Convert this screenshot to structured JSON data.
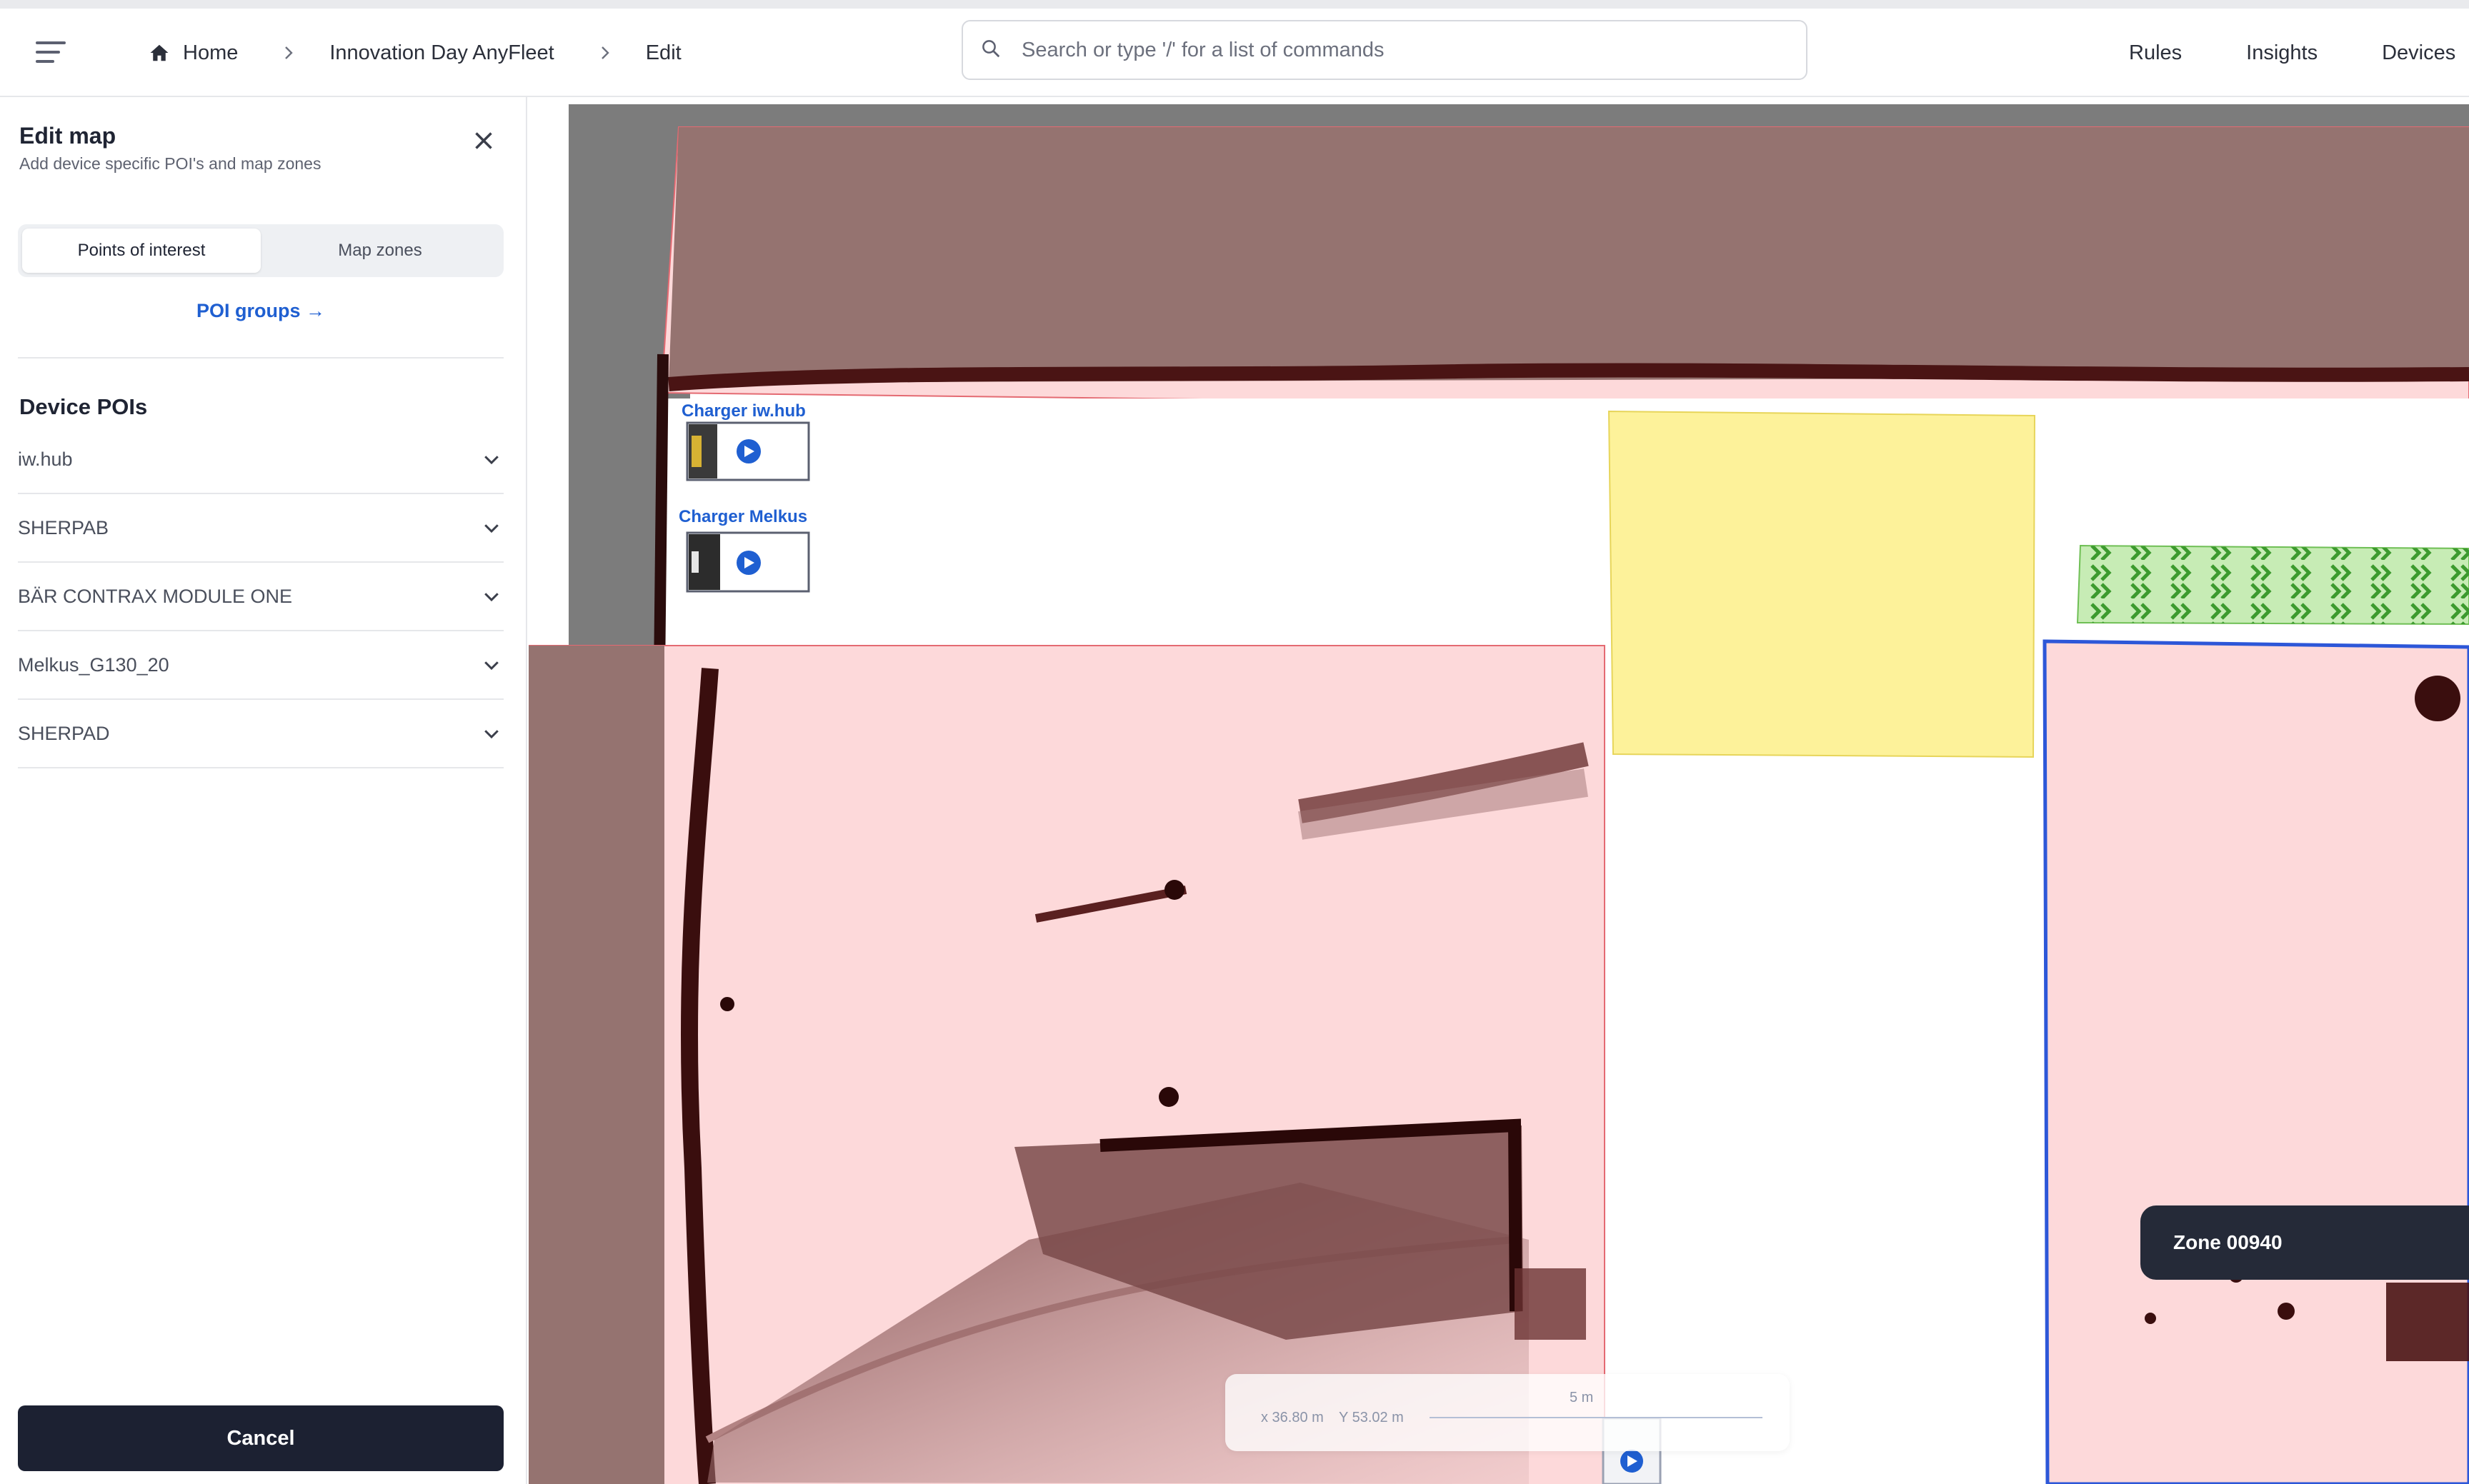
{
  "header": {
    "breadcrumb": {
      "home": "Home",
      "fleet": "Innovation Day AnyFleet",
      "current": "Edit"
    },
    "search_placeholder": "Search or type '/' for a list of commands",
    "nav": {
      "rules": "Rules",
      "insights": "Insights",
      "devices": "Devices"
    }
  },
  "sidebar": {
    "title": "Edit map",
    "subtitle": "Add device specific POI's and map zones",
    "tabs": {
      "poi": "Points of interest",
      "zones": "Map zones"
    },
    "poi_groups_link": "POI groups →",
    "section_title": "Device POIs",
    "devices": [
      "iw.hub",
      "SHERPAB",
      "BÄR CONTRAX MODULE ONE",
      "Melkus_G130_20",
      "SHERPAD"
    ],
    "cancel_label": "Cancel"
  },
  "map": {
    "charger_1": "Charger iw.hub",
    "charger_2": "Charger Melkus",
    "zone_tooltip": "Zone 00940",
    "coords": {
      "x": "x 36.80 m",
      "y": "Y 53.02 m",
      "scale": "5 m"
    }
  },
  "colors": {
    "forbidden_zone": "#fdd9da",
    "obstacle": "#5a1f1f",
    "speed_zone": "#fdf29a",
    "one_way_zone": "#c7ecb5",
    "selected_zone_border": "#2d57d8",
    "accent": "#1f5fd1",
    "primary_button": "#1c2132"
  },
  "icons": [
    "menu-icon",
    "home-icon",
    "chevron-right-icon",
    "search-icon",
    "close-icon",
    "chevron-down-icon",
    "arrow-right-icon",
    "play-icon"
  ]
}
